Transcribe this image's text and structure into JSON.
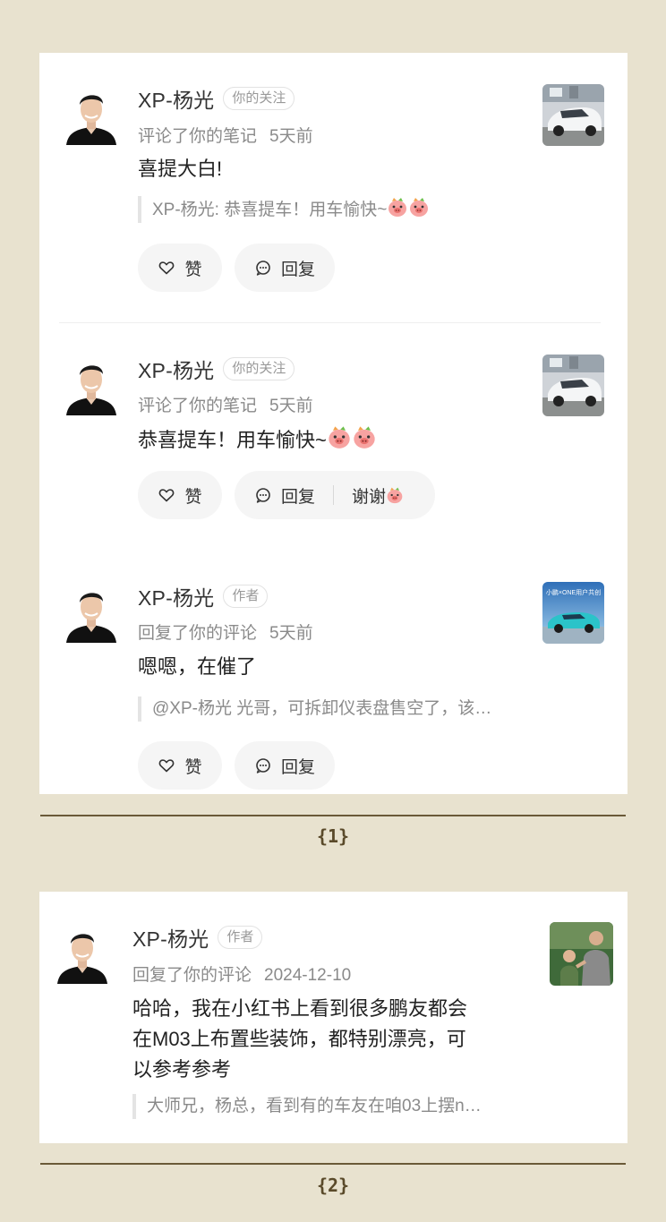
{
  "notifications": [
    {
      "name": "XP-杨光",
      "tag": "你的关注",
      "action": "评论了你的笔记",
      "time": "5天前",
      "content": "喜提大白!",
      "quote": "XP-杨光: 恭喜提车！用车愉快~",
      "like_label": "赞",
      "reply_label": "回复"
    },
    {
      "name": "XP-杨光",
      "tag": "你的关注",
      "action": "评论了你的笔记",
      "time": "5天前",
      "content": "恭喜提车！用车愉快~",
      "like_label": "赞",
      "reply_label": "回复",
      "reply_extra": "谢谢"
    },
    {
      "name": "XP-杨光",
      "tag": "作者",
      "action": "回复了你的评论",
      "time": "5天前",
      "content": "嗯嗯，在催了",
      "quote": "@XP-杨光 光哥，可拆卸仪表盘售空了，该…",
      "like_label": "赞",
      "reply_label": "回复"
    },
    {
      "name": "XP-杨光",
      "tag": "作者",
      "action": "回复了你的评论",
      "time": "2024-12-10",
      "content_lines": [
        "哈哈，我在小红书上看到很多鹏友都会",
        "在M03上布置些装饰，都特别漂亮，可",
        "以参考参考"
      ],
      "quote": "大师兄，杨总，看到有的车友在咱03上摆n…"
    }
  ],
  "thumb3_caption": "小鹏×ONE用户共创",
  "page_labels": [
    "{1}",
    "{2}"
  ],
  "icons": {
    "like": "heart-outline-icon",
    "reply": "chat-bubble-icon",
    "emoji": "pig-face-emoji"
  },
  "colors": {
    "background": "#e8e2cf",
    "rule": "#6a5a38",
    "button_bg": "#f5f5f5"
  }
}
